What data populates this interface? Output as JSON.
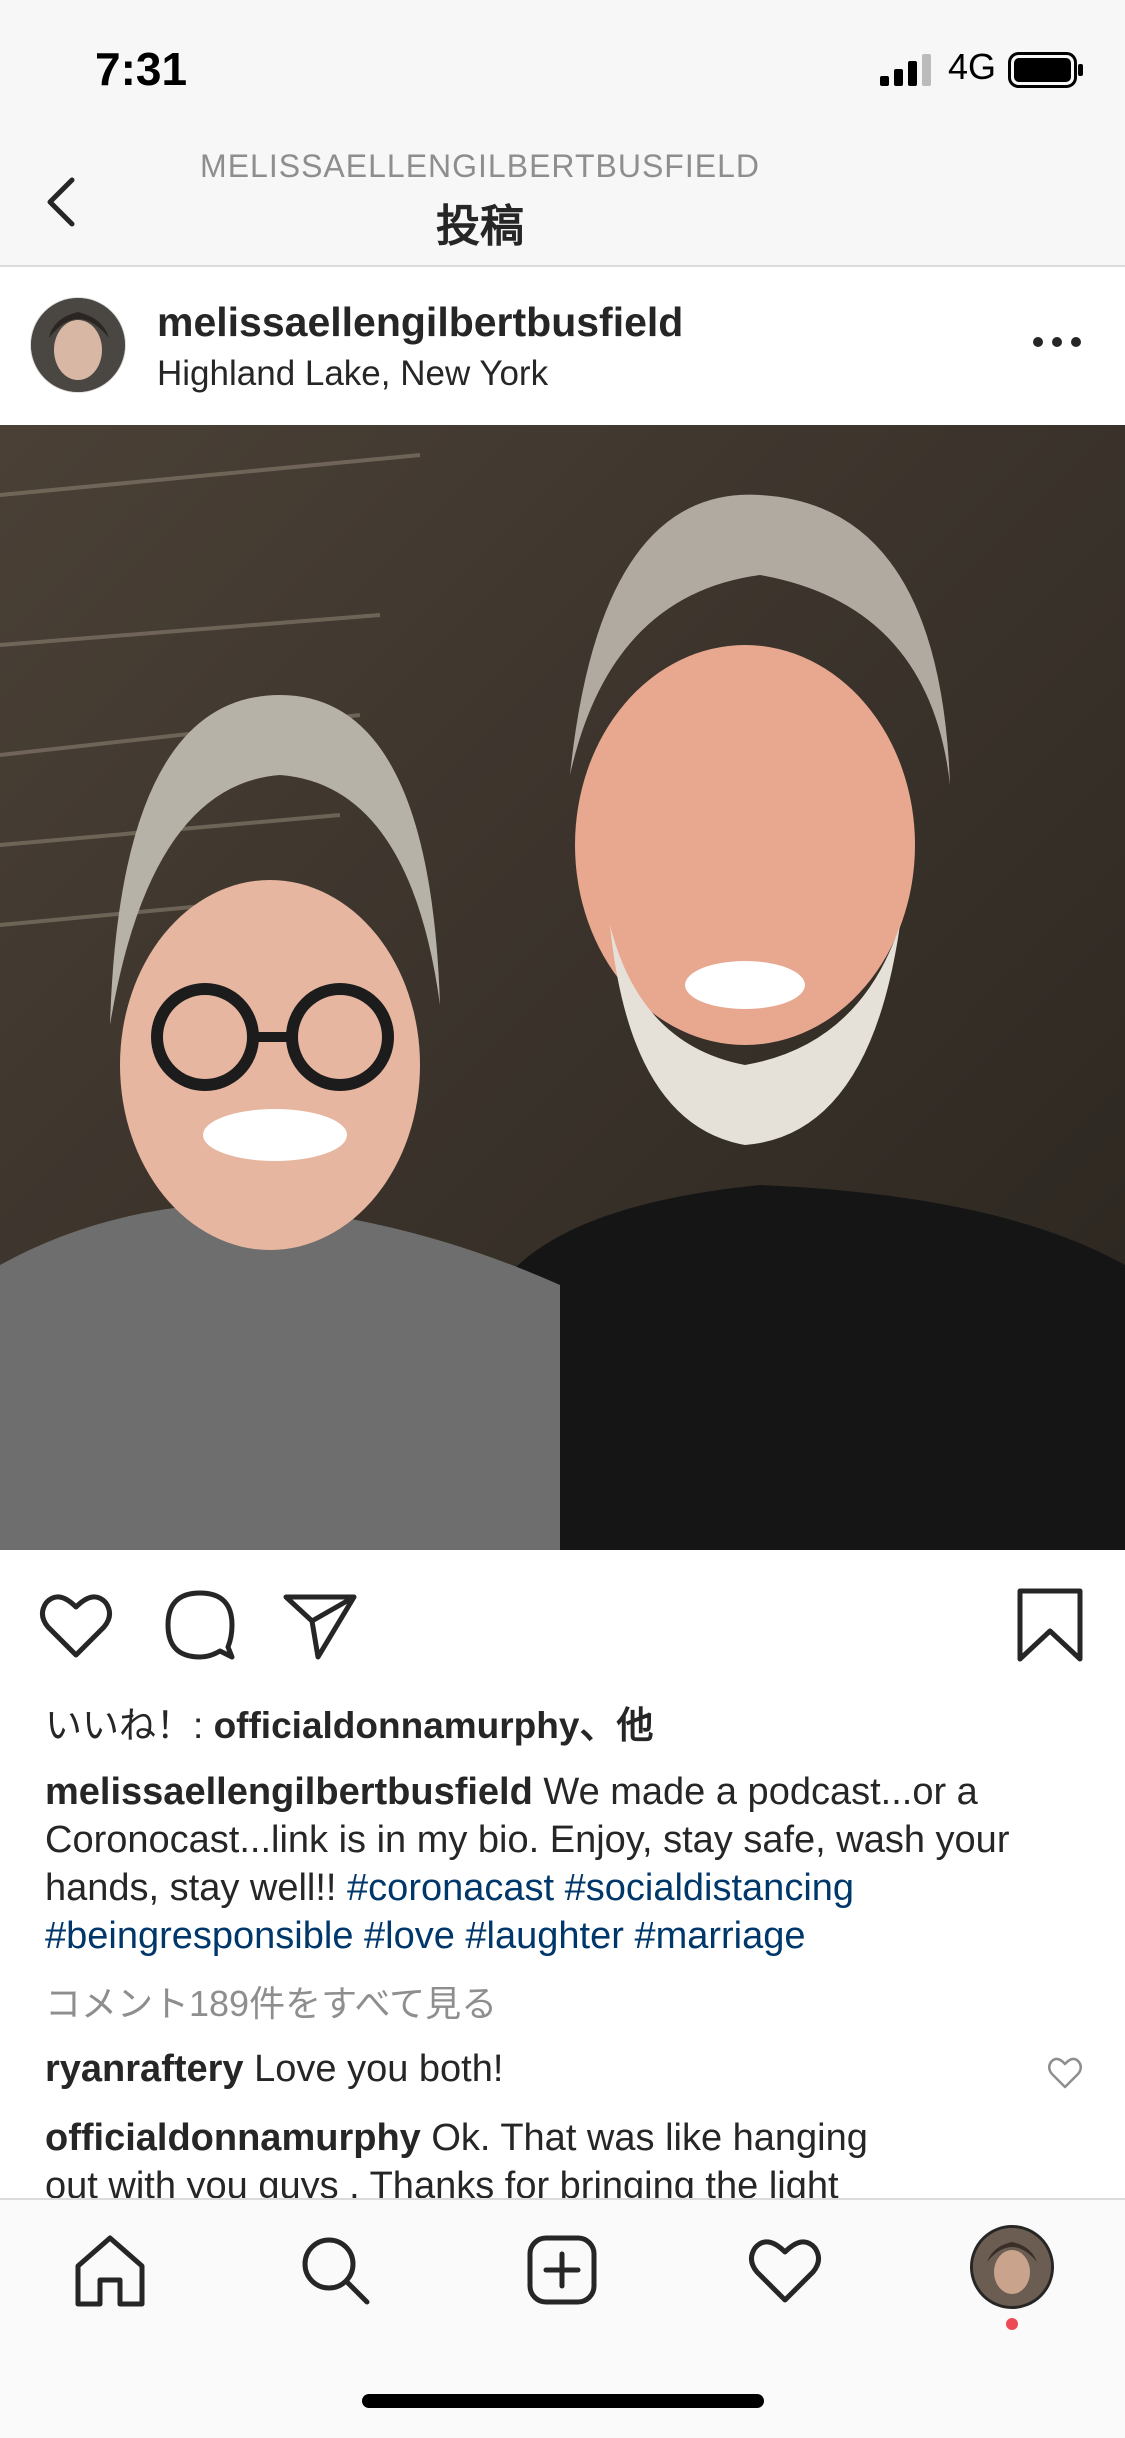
{
  "status_bar": {
    "time": "7:31",
    "network": "4G"
  },
  "nav": {
    "subtitle": "MELISSAELLENGILBERTBUSFIELD",
    "title": "投稿"
  },
  "post": {
    "username": "melissaellengilbertbusfield",
    "location": "Highland Lake, New York",
    "likes_prefix": "いいね！: ",
    "likes_user": "officialdonnamurphy",
    "likes_suffix": "、他",
    "caption_user": "melissaellengilbertbusfield",
    "caption_text": " We made a podcast...or a Coronocast...link is in my bio. Enjoy, stay safe, wash your hands, stay well!! ",
    "hashtags": [
      "#coronacast",
      "#socialdistancing",
      "#beingresponsible",
      "#love",
      "#laughter",
      "#marriage"
    ],
    "view_comments": "コメント189件をすべて見る",
    "comments": [
      {
        "user": "ryanraftery",
        "text": " Love you both!"
      },
      {
        "user": "officialdonnamurphy",
        "text": " Ok. That was like hanging",
        "line2": "out with you guys . Thanks for bringing the light"
      }
    ]
  },
  "icons": {
    "back": "chevron-left-icon",
    "more": "more-horizontal-icon",
    "like": "heart-icon",
    "comment": "comment-icon",
    "share": "paper-plane-icon",
    "save": "bookmark-icon",
    "tabs": [
      "home-icon",
      "search-icon",
      "add-post-icon",
      "activity-heart-icon",
      "profile-avatar"
    ]
  },
  "colors": {
    "hashtag": "#00376b",
    "muted": "#8e8e8e",
    "notification": "#ed4956"
  }
}
